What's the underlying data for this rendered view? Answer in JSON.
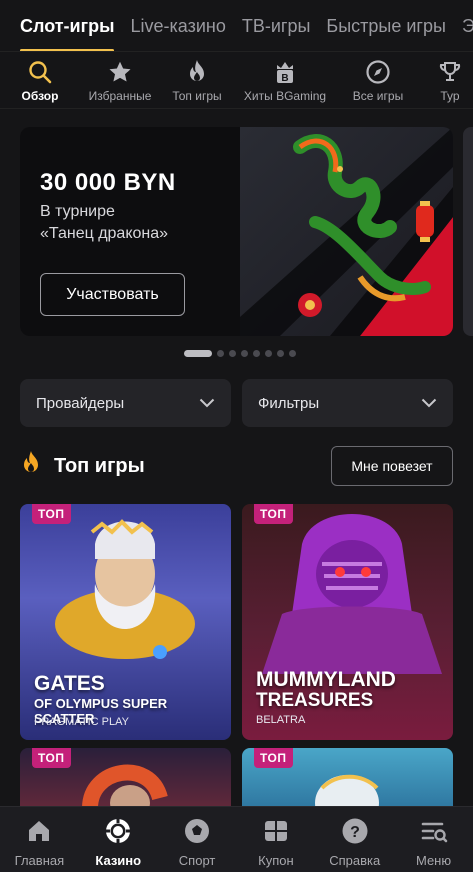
{
  "top_tabs": [
    {
      "label": "Слот-игры",
      "active": true
    },
    {
      "label": "Live-казино"
    },
    {
      "label": "ТВ-игры"
    },
    {
      "label": "Быстрые игры"
    },
    {
      "label": "Э"
    }
  ],
  "categories": [
    {
      "label": "Обзор",
      "icon": "search-icon",
      "active": true
    },
    {
      "label": "Избранные",
      "icon": "star-icon"
    },
    {
      "label": "Топ игры",
      "icon": "flame-icon"
    },
    {
      "label": "Хиты BGaming",
      "icon": "bgaming-icon"
    },
    {
      "label": "Все игры",
      "icon": "compass-icon"
    },
    {
      "label": "Тур",
      "icon": "trophy-icon"
    }
  ],
  "banner": {
    "amount": "30 000 BYN",
    "line1": "В турнире",
    "line2": "«Танец дракона»",
    "button": "Участвовать"
  },
  "carousel": {
    "count": 8,
    "active_index": 0
  },
  "filters": {
    "providers": "Провайдеры",
    "filters": "Фильтры"
  },
  "section": {
    "title": "Топ игры",
    "lucky_button": "Мне повезет"
  },
  "games": [
    {
      "badge": "ТОП",
      "title1": "GATES",
      "title2": "OF OLYMPUS SUPER SCATTER",
      "provider": "PRAGMATIC PLAY"
    },
    {
      "badge": "ТОП",
      "title1": "MUMMYLAND",
      "title2": "TREASURES",
      "provider": "BELATRA"
    },
    {
      "badge": "ТОП"
    },
    {
      "badge": "ТОП"
    }
  ],
  "bottom_nav": [
    {
      "label": "Главная",
      "icon": "home-icon"
    },
    {
      "label": "Казино",
      "icon": "casino-chip-icon",
      "active": true
    },
    {
      "label": "Спорт",
      "icon": "soccer-ball-icon"
    },
    {
      "label": "Купон",
      "icon": "coupon-icon"
    },
    {
      "label": "Справка",
      "icon": "help-icon"
    },
    {
      "label": "Меню",
      "icon": "menu-icon"
    }
  ],
  "colors": {
    "accent": "#f2c14e",
    "badge": "#c4217a",
    "background": "#151517"
  }
}
